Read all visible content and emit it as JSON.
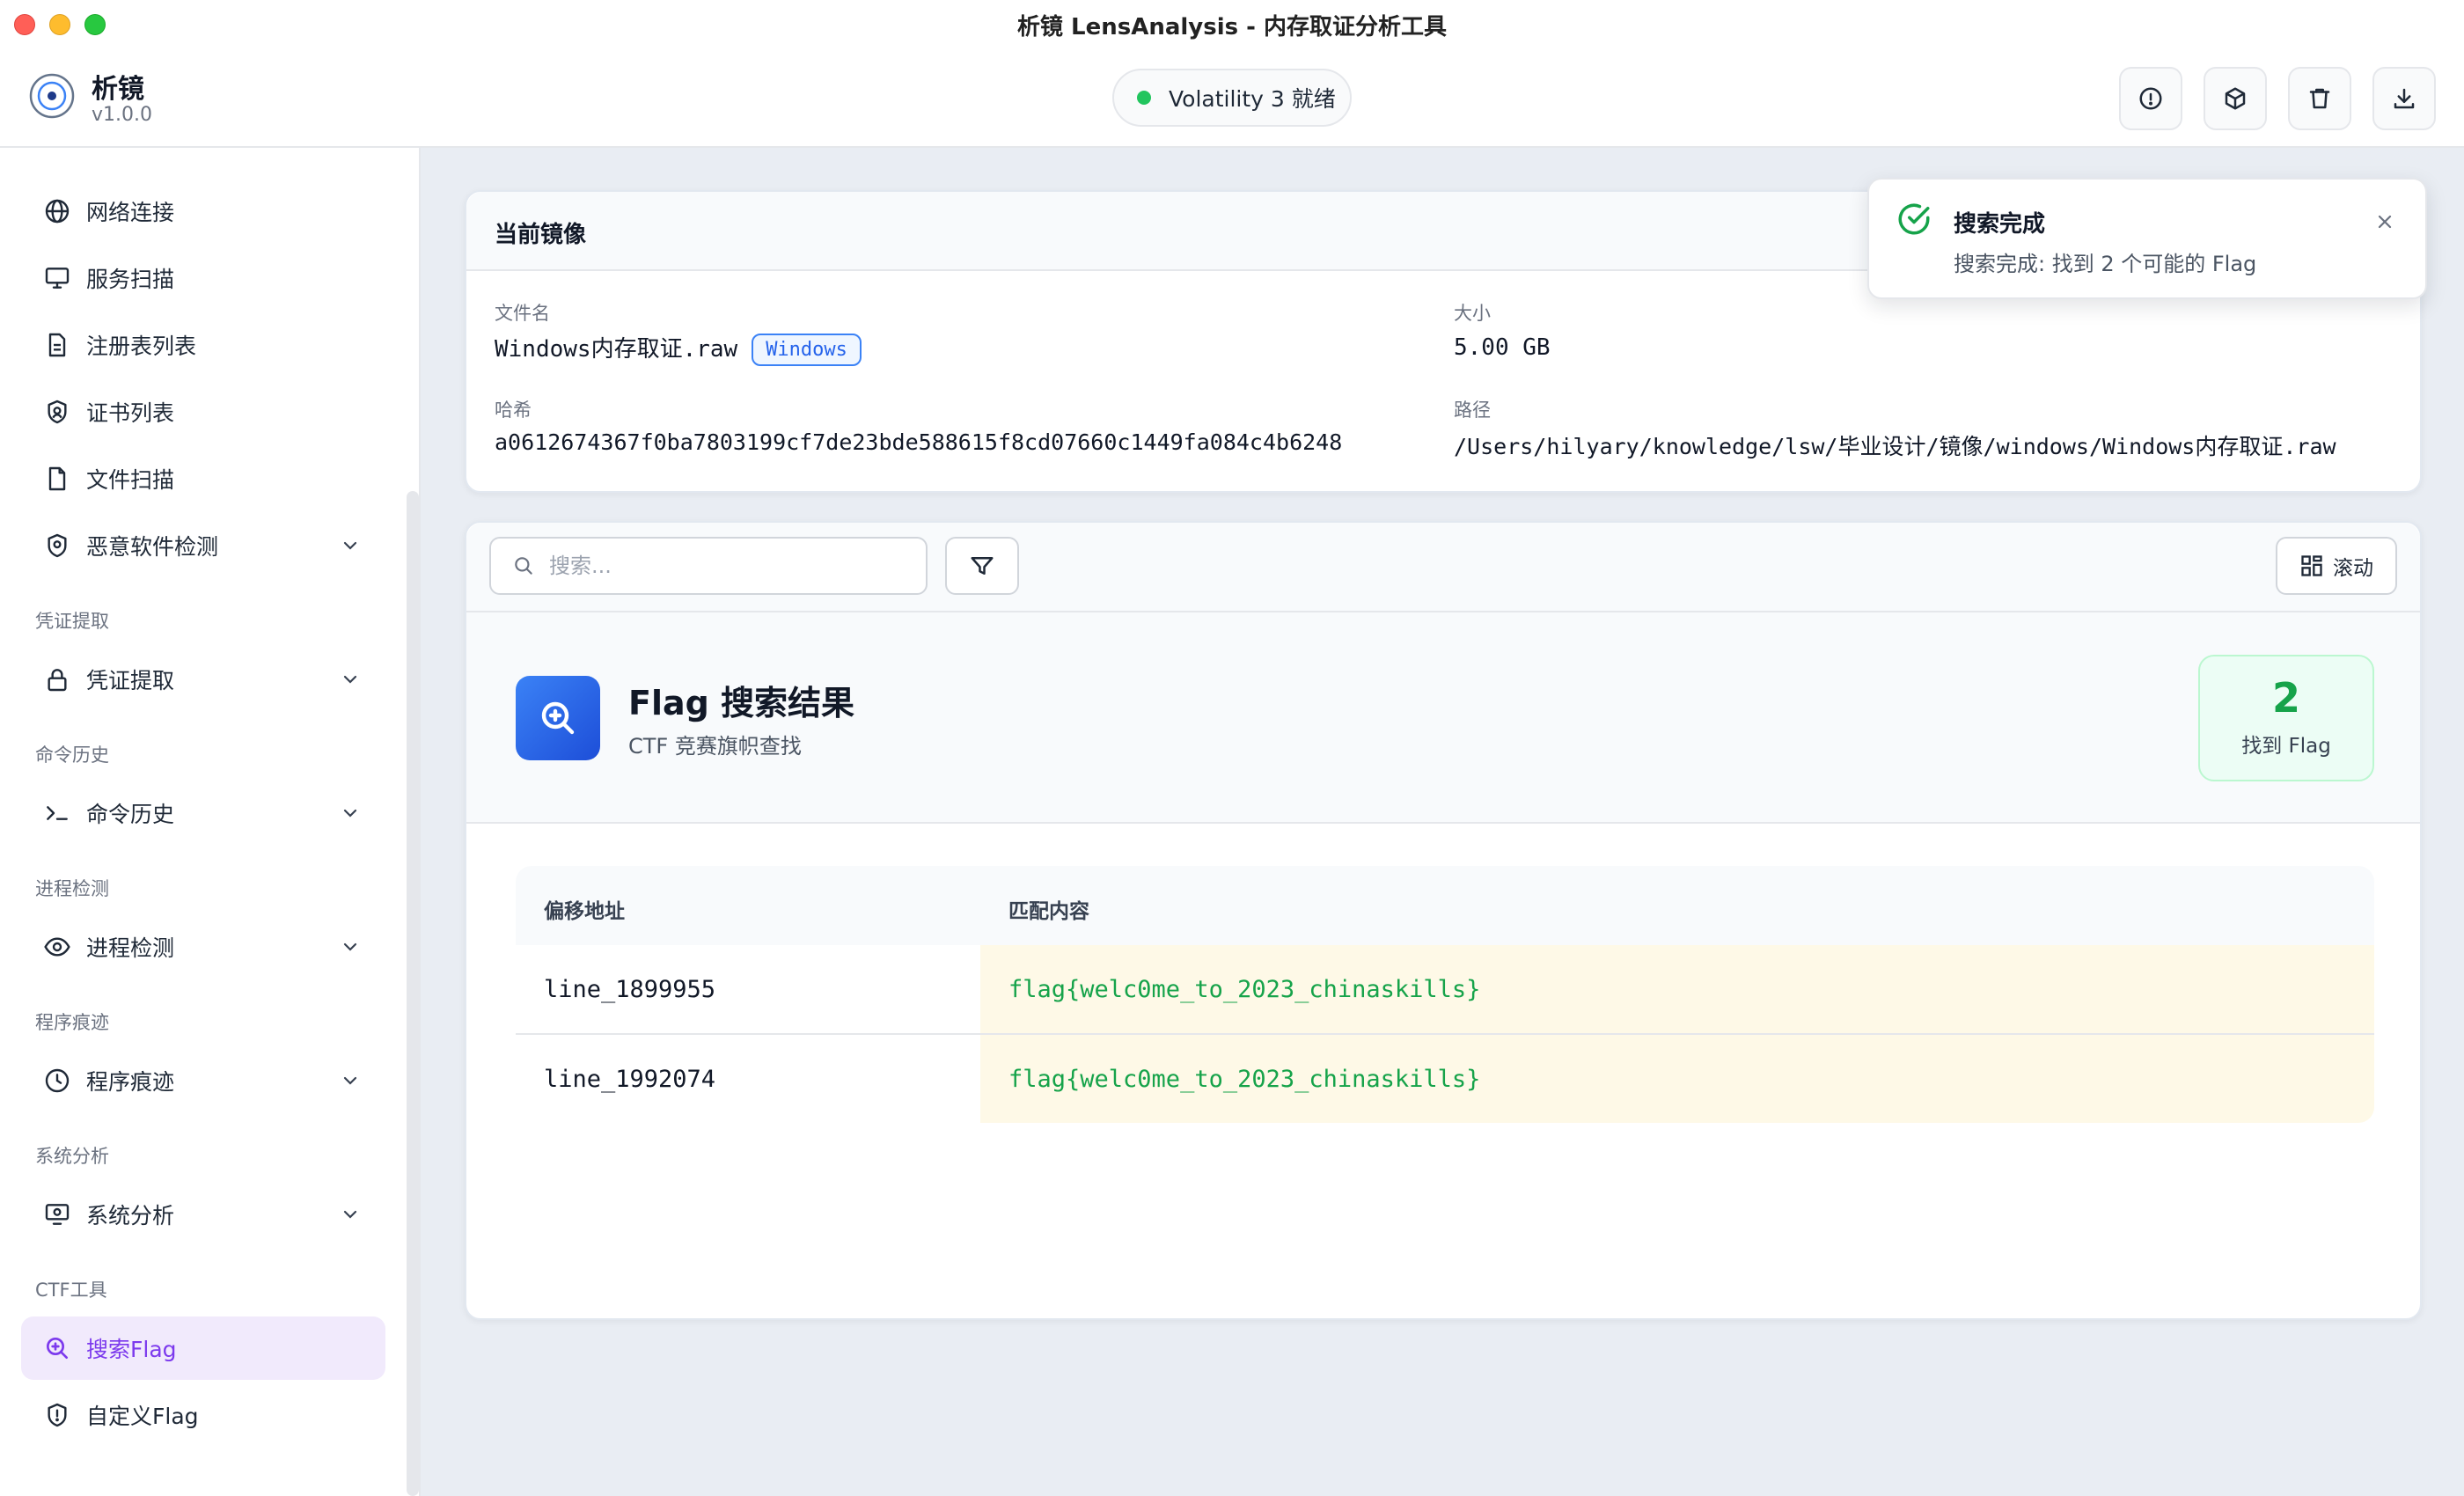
{
  "window": {
    "title": "析镜 LensAnalysis - 内存取证分析工具"
  },
  "app": {
    "name": "析镜",
    "version": "v1.0.0"
  },
  "status": {
    "label": "Volatility 3 就绪",
    "color": "#22c55e"
  },
  "header_actions": [
    {
      "icon": "info-icon"
    },
    {
      "icon": "cube-icon"
    },
    {
      "icon": "trash-icon"
    },
    {
      "icon": "download-icon"
    }
  ],
  "sidebar": {
    "items": [
      {
        "label": "网络连接",
        "icon": "globe-icon"
      },
      {
        "label": "服务扫描",
        "icon": "monitor-icon"
      },
      {
        "label": "注册表列表",
        "icon": "document-icon"
      },
      {
        "label": "证书列表",
        "icon": "badge-icon"
      },
      {
        "label": "文件扫描",
        "icon": "file-icon"
      },
      {
        "label": "恶意软件检测",
        "icon": "shield-icon"
      }
    ],
    "sections": [
      {
        "title": "凭证提取",
        "item": "凭证提取",
        "icon": "lock-icon"
      },
      {
        "title": "命令历史",
        "item": "命令历史",
        "icon": "terminal-icon"
      },
      {
        "title": "进程检测",
        "item": "进程检测",
        "icon": "eye-icon"
      },
      {
        "title": "程序痕迹",
        "item": "程序痕迹",
        "icon": "clock-icon"
      },
      {
        "title": "系统分析",
        "item": "系统分析",
        "icon": "screen-icon"
      }
    ],
    "ctf": {
      "title": "CTF工具",
      "items": [
        {
          "label": "搜索Flag",
          "icon": "search-plus-icon",
          "active": true
        },
        {
          "label": "自定义Flag",
          "icon": "shield-exclaim-icon"
        }
      ]
    }
  },
  "image_card": {
    "title": "当前镜像",
    "filename_label": "文件名",
    "filename": "Windows内存取证.raw",
    "os_badge": "Windows",
    "size_label": "大小",
    "size": "5.00 GB",
    "hash_label": "哈希",
    "hash": "a0612674367f0ba7803199cf7de23bde588615f8cd07660c1449fa084c4b6248",
    "path_label": "路径",
    "path": "/Users/hilyary/knowledge/lsw/毕业设计/镜像/windows/Windows内存取证.raw"
  },
  "toolbar": {
    "search_placeholder": "搜索...",
    "scroll_label": "滚动"
  },
  "flag_results": {
    "title": "Flag 搜索结果",
    "subtitle": "CTF 竞赛旗帜查找",
    "count": "2",
    "count_label": "找到 Flag",
    "columns": [
      "偏移地址",
      "匹配内容"
    ],
    "rows": [
      {
        "offset": "line_1899955",
        "match": "flag{welc0me_to_2023_chinaskills}"
      },
      {
        "offset": "line_1992074",
        "match": "flag{welc0me_to_2023_chinaskills}"
      }
    ]
  },
  "toast": {
    "title": "搜索完成",
    "message": "搜索完成: 找到 2 个可能的 Flag"
  }
}
